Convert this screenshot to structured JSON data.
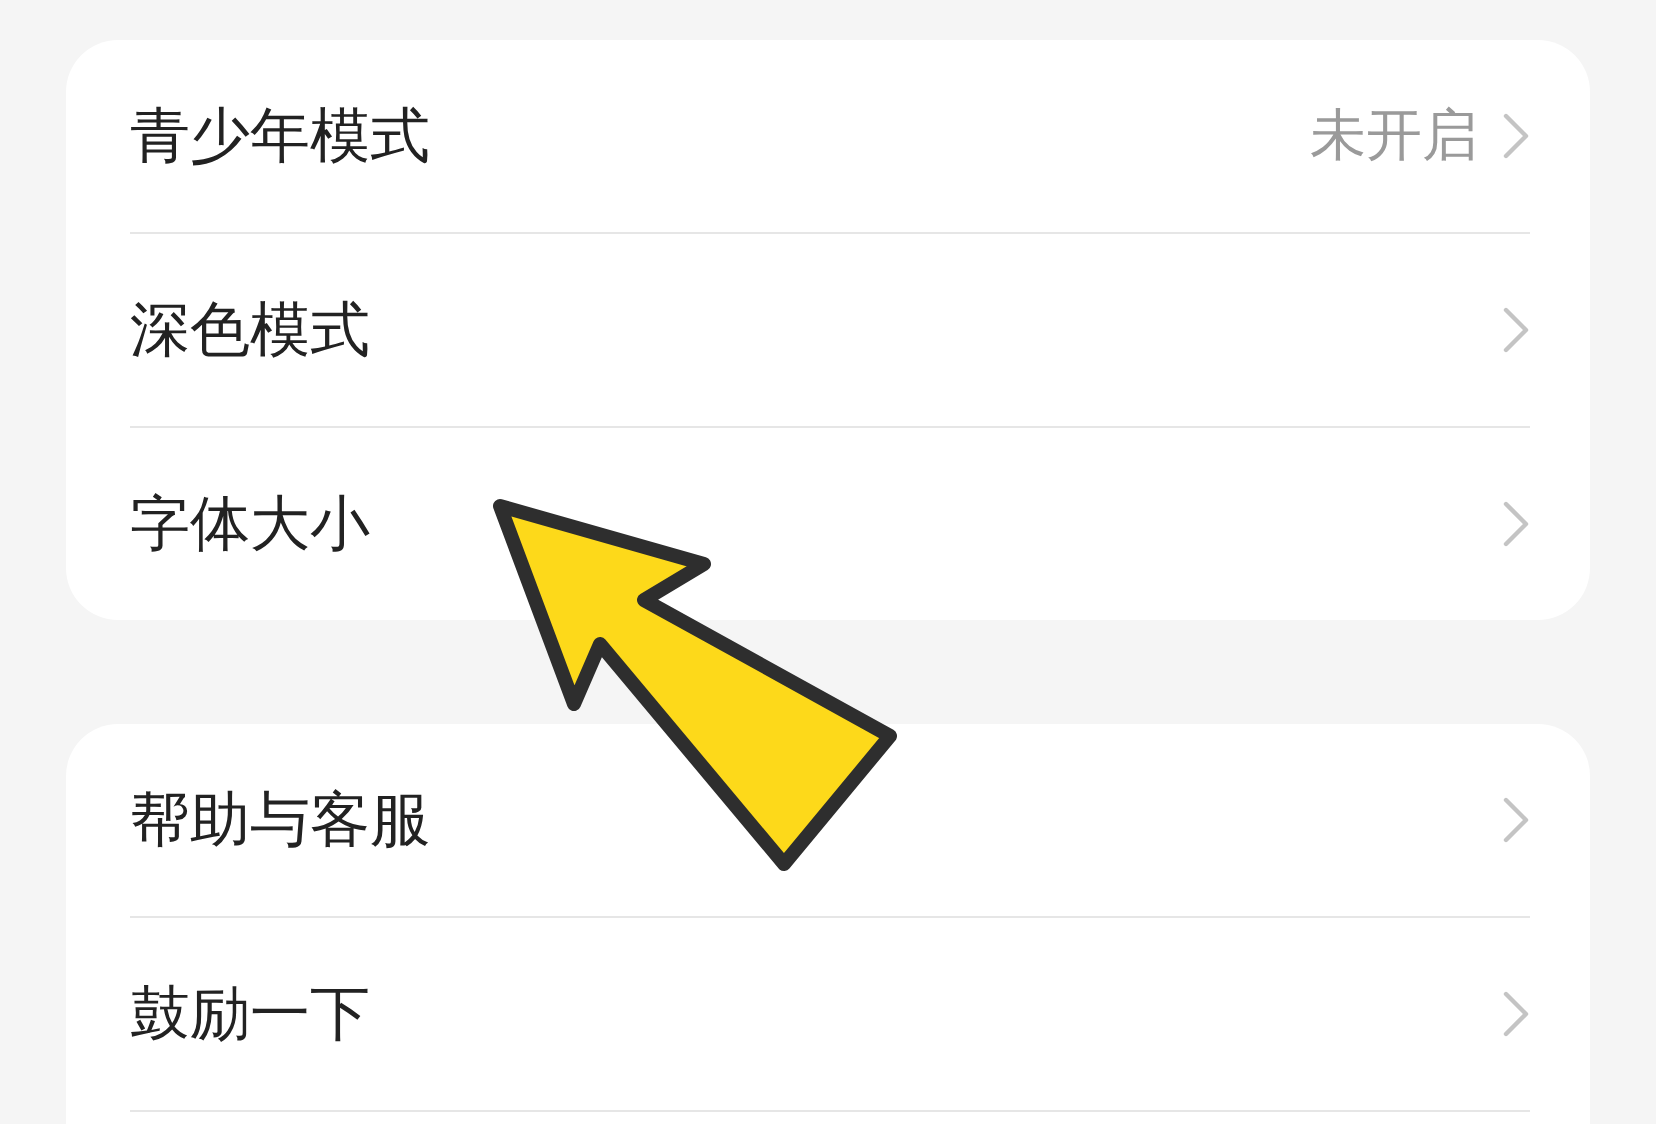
{
  "sections": [
    {
      "items": [
        {
          "label": "青少年模式",
          "value": "未开启"
        },
        {
          "label": "深色模式"
        },
        {
          "label": "字体大小"
        }
      ]
    },
    {
      "items": [
        {
          "label": "帮助与客服"
        },
        {
          "label": "鼓励一下"
        }
      ]
    }
  ]
}
